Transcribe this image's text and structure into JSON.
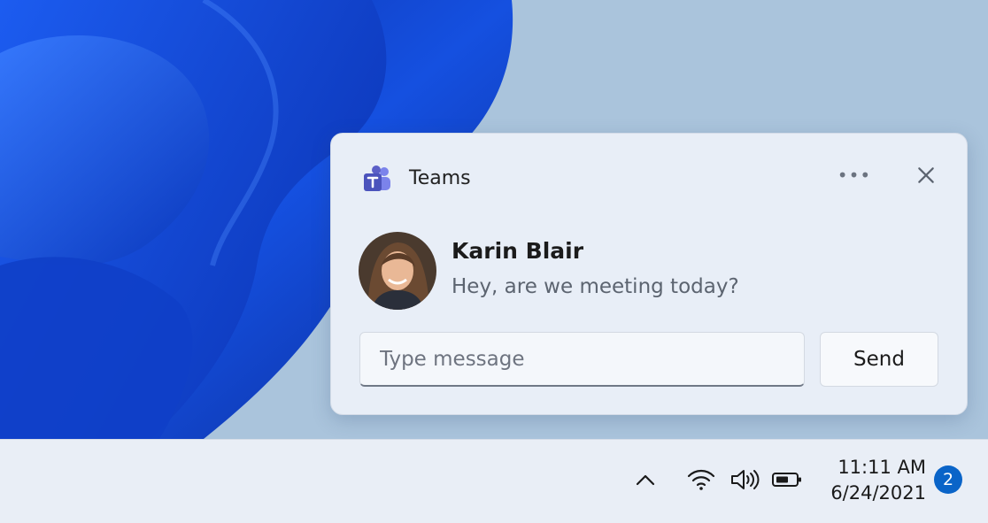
{
  "notification": {
    "app_name": "Teams",
    "app_icon": "teams-logo-icon",
    "more_icon": "more-options-icon",
    "more_glyph": "•••",
    "close_icon": "close-icon",
    "sender_name": "Karin Blair",
    "message": "Hey, are we meeting today?",
    "reply_placeholder": "Type message",
    "send_label": "Send"
  },
  "taskbar": {
    "tray_icons": [
      "chevron-up-icon",
      "wifi-icon",
      "speaker-icon",
      "battery-icon"
    ],
    "time": "11:11 AM",
    "date": "6/24/2021",
    "notification_count": "2"
  },
  "colors": {
    "accent": "#0a64c8",
    "teams_purple": "#5b5fc7",
    "wallpaper_blue": "#1450d8",
    "desktop_bg": "#aac4dc",
    "taskbar_bg": "#e9eef6"
  }
}
